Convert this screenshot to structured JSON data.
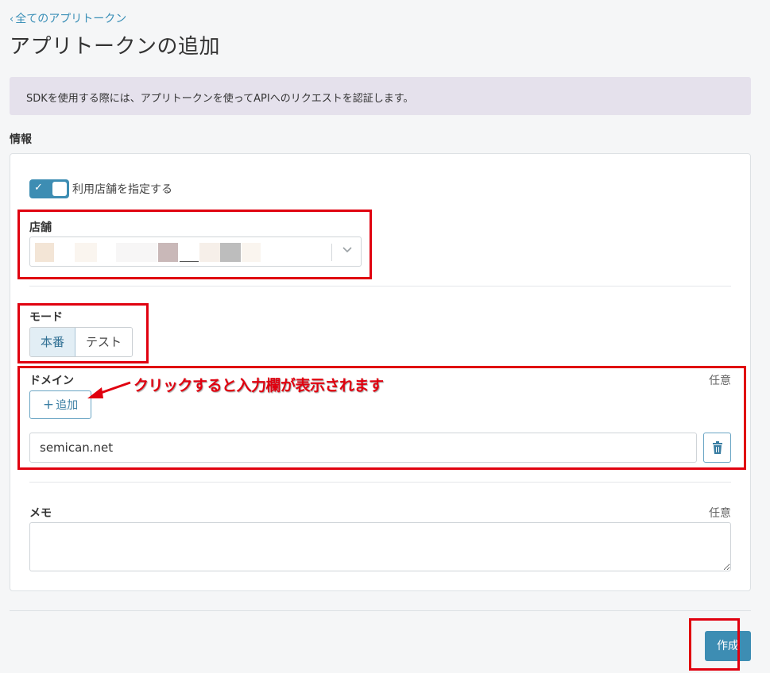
{
  "header": {
    "back_chevron": "‹",
    "back_link": "全てのアプリトークン",
    "title": "アプリトークンの追加"
  },
  "notice": "SDKを使用する際には、アプリトークンを使ってAPIへのリクエストを認証します。",
  "section": "情報",
  "form": {
    "toggle_label": "利用店舗を指定する",
    "toggle_on": true,
    "store_label": "店舗",
    "mode_label": "モード",
    "mode_options": [
      "本番",
      "テスト"
    ],
    "mode_selected": "本番",
    "domain_label": "ドメイン",
    "domain_optional": "任意",
    "add_label": "追加",
    "add_plus": "+",
    "domain_value": "semican.net",
    "memo_label": "メモ",
    "memo_optional": "任意"
  },
  "annotation": {
    "callout": "クリックすると入力欄が表示されます",
    "color": "#e0000f"
  },
  "footer": {
    "create_label": "作成"
  },
  "colors": {
    "accent": "#3d8db3",
    "link": "#3a8fb7",
    "notice_bg": "#e5e1ec"
  }
}
